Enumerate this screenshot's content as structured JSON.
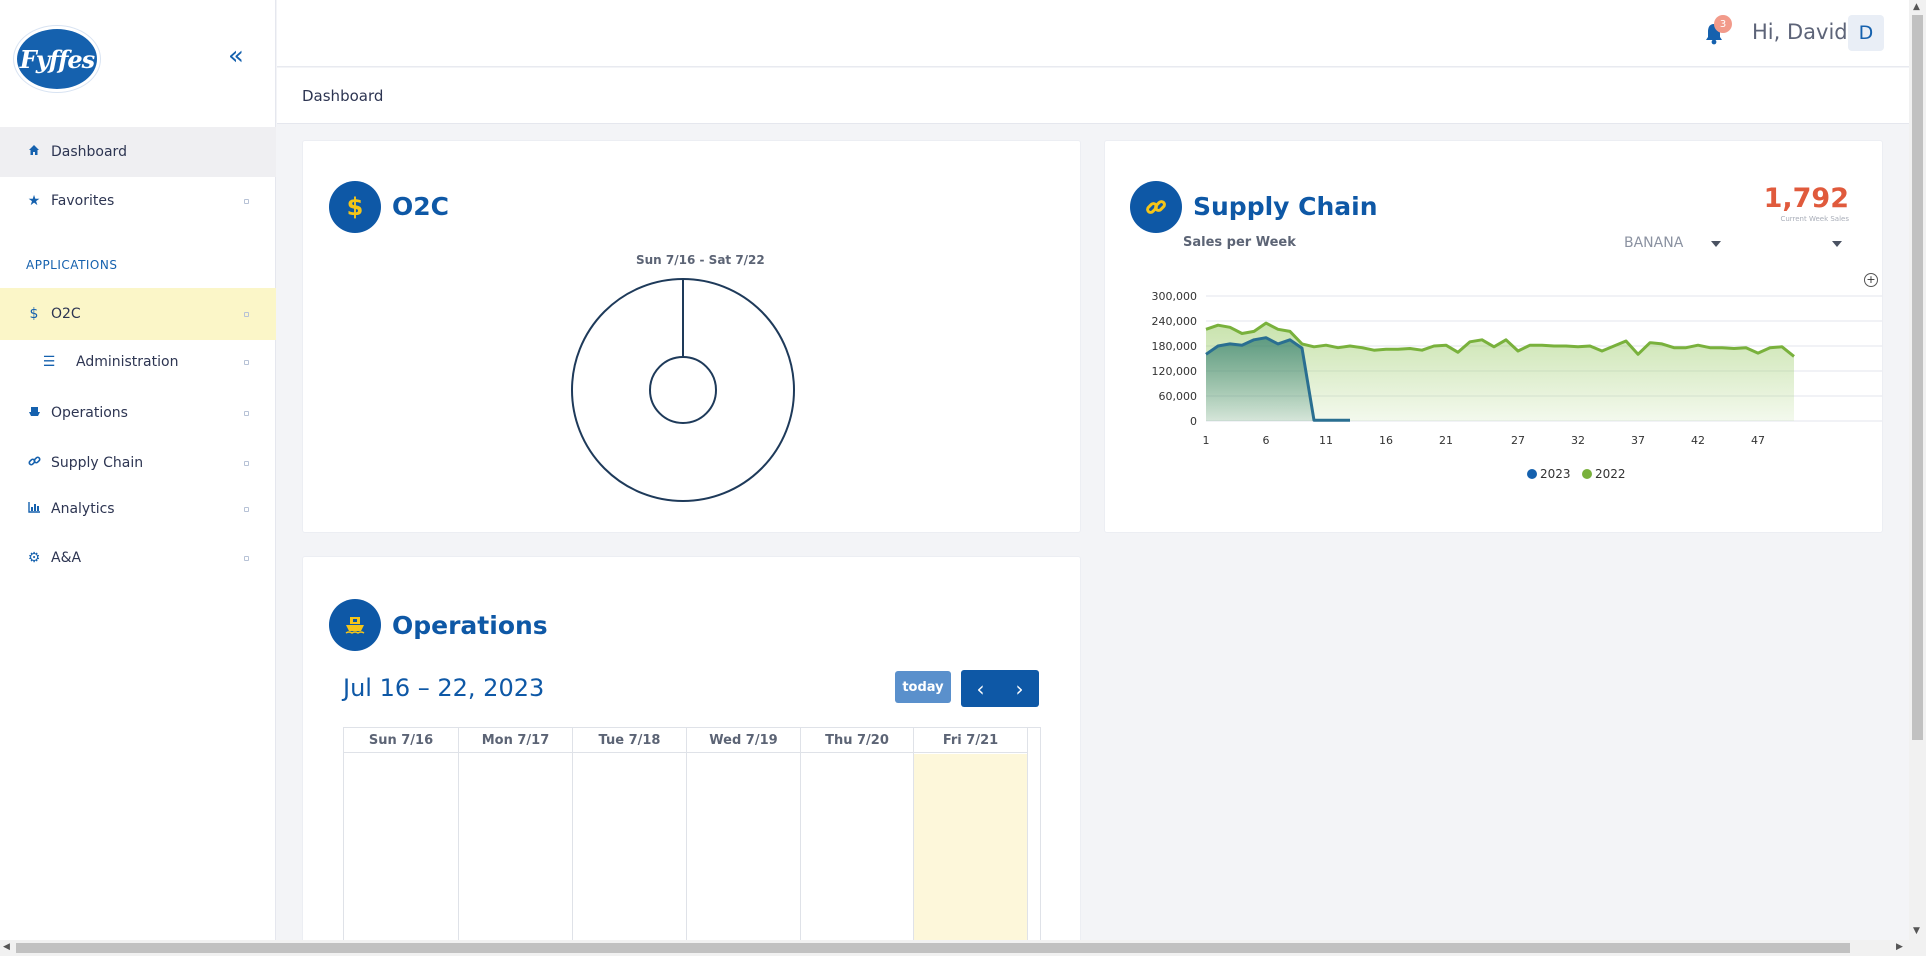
{
  "brand": {
    "logo_text": "Fyffes"
  },
  "header": {
    "notification_count": "3",
    "greeting": "Hi, David",
    "avatar_initial": "D"
  },
  "breadcrumb": "Dashboard",
  "sidebar": {
    "items": [
      {
        "label": "Dashboard",
        "icon": "home-icon"
      },
      {
        "label": "Favorites",
        "icon": "star-icon"
      }
    ],
    "section_label": "APPLICATIONS",
    "apps": [
      {
        "label": "O2C",
        "icon": "dollar-icon"
      },
      {
        "label": "Administration",
        "icon": "list-icon"
      },
      {
        "label": "Operations",
        "icon": "ship-icon"
      },
      {
        "label": "Supply Chain",
        "icon": "link-icon"
      },
      {
        "label": "Analytics",
        "icon": "bar-chart-icon"
      },
      {
        "label": "A&A",
        "icon": "gear-icon"
      }
    ]
  },
  "o2c": {
    "title": "O2C",
    "date_range_label": "Sun 7/16 - Sat 7/22"
  },
  "supply_chain": {
    "title": "Supply Chain",
    "kpi_value": "1,792",
    "kpi_caption": "Current Week Sales",
    "subtitle": "Sales per Week",
    "product_select": "BANANA"
  },
  "operations": {
    "title": "Operations",
    "range_title": "Jul 16 – 22, 2023",
    "today_label": "today",
    "days": [
      "Sun 7/16",
      "Mon 7/17",
      "Tue 7/18",
      "Wed 7/19",
      "Thu 7/20",
      "Fri 7/21"
    ]
  },
  "colors": {
    "primary": "#0e58a6",
    "accent_yellow": "#f5c518",
    "series_2023": "#1561ae",
    "series_2022": "#79b13c",
    "kpi": "#e05a3c"
  },
  "chart_data": {
    "type": "area",
    "title": "",
    "xlabel": "",
    "ylabel": "",
    "ylim": [
      0,
      300000
    ],
    "y_ticks": [
      "300,000",
      "240,000",
      "180,000",
      "120,000",
      "60,000",
      "0"
    ],
    "x_ticks": [
      "1",
      "6",
      "11",
      "16",
      "21",
      "27",
      "32",
      "37",
      "42",
      "47"
    ],
    "legend_position": "bottom",
    "series": [
      {
        "name": "2023",
        "x": [
          1,
          2,
          3,
          4,
          5,
          6,
          7,
          8,
          9,
          10,
          11,
          12,
          13
        ],
        "values": [
          160000,
          180000,
          185000,
          182000,
          195000,
          200000,
          185000,
          195000,
          175000,
          2000,
          2000,
          2000,
          2000
        ]
      },
      {
        "name": "2022",
        "x": [
          1,
          2,
          3,
          4,
          5,
          6,
          7,
          8,
          9,
          10,
          11,
          12,
          13,
          14,
          15,
          16,
          17,
          18,
          19,
          20,
          21,
          22,
          23,
          24,
          25,
          26,
          27,
          28,
          29,
          30,
          31,
          32,
          33,
          34,
          35,
          36,
          37,
          38,
          39,
          40,
          41,
          42,
          43,
          44,
          45,
          46,
          47,
          48,
          49,
          50
        ],
        "values": [
          220000,
          230000,
          225000,
          210000,
          215000,
          235000,
          220000,
          215000,
          185000,
          178000,
          182000,
          176000,
          180000,
          176000,
          170000,
          172000,
          172000,
          174000,
          170000,
          180000,
          182000,
          165000,
          190000,
          195000,
          178000,
          195000,
          168000,
          182000,
          182000,
          180000,
          180000,
          178000,
          180000,
          168000,
          180000,
          192000,
          160000,
          188000,
          185000,
          176000,
          176000,
          182000,
          176000,
          176000,
          174000,
          176000,
          163000,
          176000,
          178000,
          155000
        ]
      }
    ]
  }
}
